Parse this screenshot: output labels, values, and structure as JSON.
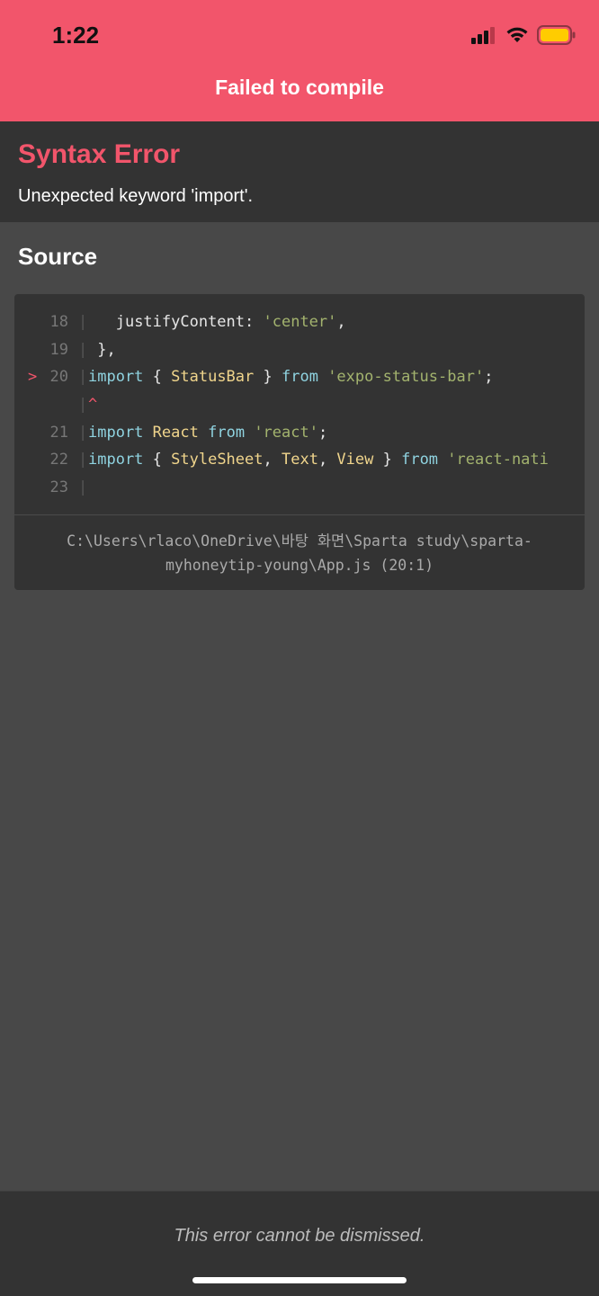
{
  "status_bar": {
    "time": "1:22",
    "signal_icon": "cellular-signal-icon",
    "wifi_icon": "wifi-icon",
    "battery_icon": "battery-icon",
    "battery_color": "#ffcc00"
  },
  "header": {
    "title": "Failed to compile",
    "background": "#f2556b"
  },
  "error": {
    "title": "Syntax Error",
    "message": "Unexpected keyword 'import'.",
    "title_color": "#f2556b"
  },
  "source": {
    "title": "Source",
    "lines": [
      {
        "number": "18",
        "code": "   justifyContent: 'center',"
      },
      {
        "number": "19",
        "code": " },"
      },
      {
        "number": "20",
        "marker": ">",
        "code": "import { StatusBar } from 'expo-status-bar';"
      },
      {
        "caret": "^"
      },
      {
        "number": "21",
        "code": "import React from 'react';"
      },
      {
        "number": "22",
        "code": "import { StyleSheet, Text, View } from 'react-nati"
      },
      {
        "number": "23",
        "code": ""
      }
    ],
    "file_path_line1": "C:\\Users\\rlaco\\OneDrive\\바탕 화면\\Sparta study\\sparta-",
    "file_path_line2": "myhoneytip-young\\App.js (20:1)"
  },
  "footer": {
    "note": "This error cannot be dismissed."
  }
}
